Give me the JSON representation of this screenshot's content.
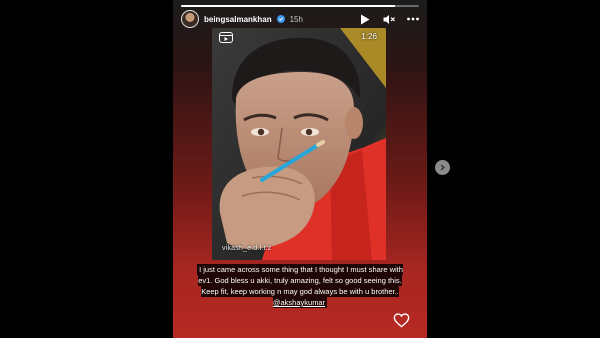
{
  "story": {
    "progress_fraction": 0.9,
    "username": "beingsalmankhan",
    "time_ago": "15h",
    "controls": {
      "play_icon": "play-icon",
      "mute_icon": "muted-speaker-icon",
      "more_icon": "more-horizontal-icon"
    }
  },
  "video": {
    "duration": "1:26",
    "watermark": "vikash_e.d.i.t.z",
    "reel_icon": "reel-clapper-icon"
  },
  "caption": {
    "text": "I just came across some thing that I thought I must share with ev1. God bless u akki, truly amazing, felt so good seeing this. Keep fit, keep working n may god always be with u brother..",
    "mention": "@akshaykumar"
  },
  "actions": {
    "like_icon": "heart-icon",
    "next_icon": "next-story-icon"
  },
  "colors": {
    "story_bottom": "#b72a23",
    "verified": "#3897f0",
    "shirt_red": "#e03128"
  }
}
